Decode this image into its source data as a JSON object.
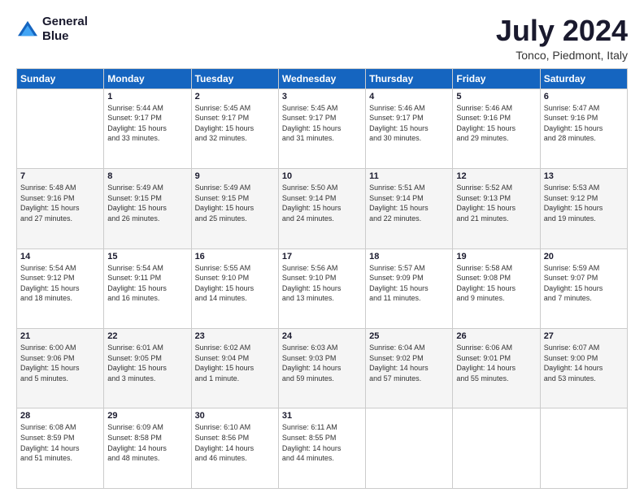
{
  "logo": {
    "line1": "General",
    "line2": "Blue"
  },
  "title": "July 2024",
  "subtitle": "Tonco, Piedmont, Italy",
  "weekdays": [
    "Sunday",
    "Monday",
    "Tuesday",
    "Wednesday",
    "Thursday",
    "Friday",
    "Saturday"
  ],
  "weeks": [
    [
      {
        "day": "",
        "info": ""
      },
      {
        "day": "1",
        "info": "Sunrise: 5:44 AM\nSunset: 9:17 PM\nDaylight: 15 hours\nand 33 minutes."
      },
      {
        "day": "2",
        "info": "Sunrise: 5:45 AM\nSunset: 9:17 PM\nDaylight: 15 hours\nand 32 minutes."
      },
      {
        "day": "3",
        "info": "Sunrise: 5:45 AM\nSunset: 9:17 PM\nDaylight: 15 hours\nand 31 minutes."
      },
      {
        "day": "4",
        "info": "Sunrise: 5:46 AM\nSunset: 9:17 PM\nDaylight: 15 hours\nand 30 minutes."
      },
      {
        "day": "5",
        "info": "Sunrise: 5:46 AM\nSunset: 9:16 PM\nDaylight: 15 hours\nand 29 minutes."
      },
      {
        "day": "6",
        "info": "Sunrise: 5:47 AM\nSunset: 9:16 PM\nDaylight: 15 hours\nand 28 minutes."
      }
    ],
    [
      {
        "day": "7",
        "info": "Sunrise: 5:48 AM\nSunset: 9:16 PM\nDaylight: 15 hours\nand 27 minutes."
      },
      {
        "day": "8",
        "info": "Sunrise: 5:49 AM\nSunset: 9:15 PM\nDaylight: 15 hours\nand 26 minutes."
      },
      {
        "day": "9",
        "info": "Sunrise: 5:49 AM\nSunset: 9:15 PM\nDaylight: 15 hours\nand 25 minutes."
      },
      {
        "day": "10",
        "info": "Sunrise: 5:50 AM\nSunset: 9:14 PM\nDaylight: 15 hours\nand 24 minutes."
      },
      {
        "day": "11",
        "info": "Sunrise: 5:51 AM\nSunset: 9:14 PM\nDaylight: 15 hours\nand 22 minutes."
      },
      {
        "day": "12",
        "info": "Sunrise: 5:52 AM\nSunset: 9:13 PM\nDaylight: 15 hours\nand 21 minutes."
      },
      {
        "day": "13",
        "info": "Sunrise: 5:53 AM\nSunset: 9:12 PM\nDaylight: 15 hours\nand 19 minutes."
      }
    ],
    [
      {
        "day": "14",
        "info": "Sunrise: 5:54 AM\nSunset: 9:12 PM\nDaylight: 15 hours\nand 18 minutes."
      },
      {
        "day": "15",
        "info": "Sunrise: 5:54 AM\nSunset: 9:11 PM\nDaylight: 15 hours\nand 16 minutes."
      },
      {
        "day": "16",
        "info": "Sunrise: 5:55 AM\nSunset: 9:10 PM\nDaylight: 15 hours\nand 14 minutes."
      },
      {
        "day": "17",
        "info": "Sunrise: 5:56 AM\nSunset: 9:10 PM\nDaylight: 15 hours\nand 13 minutes."
      },
      {
        "day": "18",
        "info": "Sunrise: 5:57 AM\nSunset: 9:09 PM\nDaylight: 15 hours\nand 11 minutes."
      },
      {
        "day": "19",
        "info": "Sunrise: 5:58 AM\nSunset: 9:08 PM\nDaylight: 15 hours\nand 9 minutes."
      },
      {
        "day": "20",
        "info": "Sunrise: 5:59 AM\nSunset: 9:07 PM\nDaylight: 15 hours\nand 7 minutes."
      }
    ],
    [
      {
        "day": "21",
        "info": "Sunrise: 6:00 AM\nSunset: 9:06 PM\nDaylight: 15 hours\nand 5 minutes."
      },
      {
        "day": "22",
        "info": "Sunrise: 6:01 AM\nSunset: 9:05 PM\nDaylight: 15 hours\nand 3 minutes."
      },
      {
        "day": "23",
        "info": "Sunrise: 6:02 AM\nSunset: 9:04 PM\nDaylight: 15 hours\nand 1 minute."
      },
      {
        "day": "24",
        "info": "Sunrise: 6:03 AM\nSunset: 9:03 PM\nDaylight: 14 hours\nand 59 minutes."
      },
      {
        "day": "25",
        "info": "Sunrise: 6:04 AM\nSunset: 9:02 PM\nDaylight: 14 hours\nand 57 minutes."
      },
      {
        "day": "26",
        "info": "Sunrise: 6:06 AM\nSunset: 9:01 PM\nDaylight: 14 hours\nand 55 minutes."
      },
      {
        "day": "27",
        "info": "Sunrise: 6:07 AM\nSunset: 9:00 PM\nDaylight: 14 hours\nand 53 minutes."
      }
    ],
    [
      {
        "day": "28",
        "info": "Sunrise: 6:08 AM\nSunset: 8:59 PM\nDaylight: 14 hours\nand 51 minutes."
      },
      {
        "day": "29",
        "info": "Sunrise: 6:09 AM\nSunset: 8:58 PM\nDaylight: 14 hours\nand 48 minutes."
      },
      {
        "day": "30",
        "info": "Sunrise: 6:10 AM\nSunset: 8:56 PM\nDaylight: 14 hours\nand 46 minutes."
      },
      {
        "day": "31",
        "info": "Sunrise: 6:11 AM\nSunset: 8:55 PM\nDaylight: 14 hours\nand 44 minutes."
      },
      {
        "day": "",
        "info": ""
      },
      {
        "day": "",
        "info": ""
      },
      {
        "day": "",
        "info": ""
      }
    ]
  ]
}
